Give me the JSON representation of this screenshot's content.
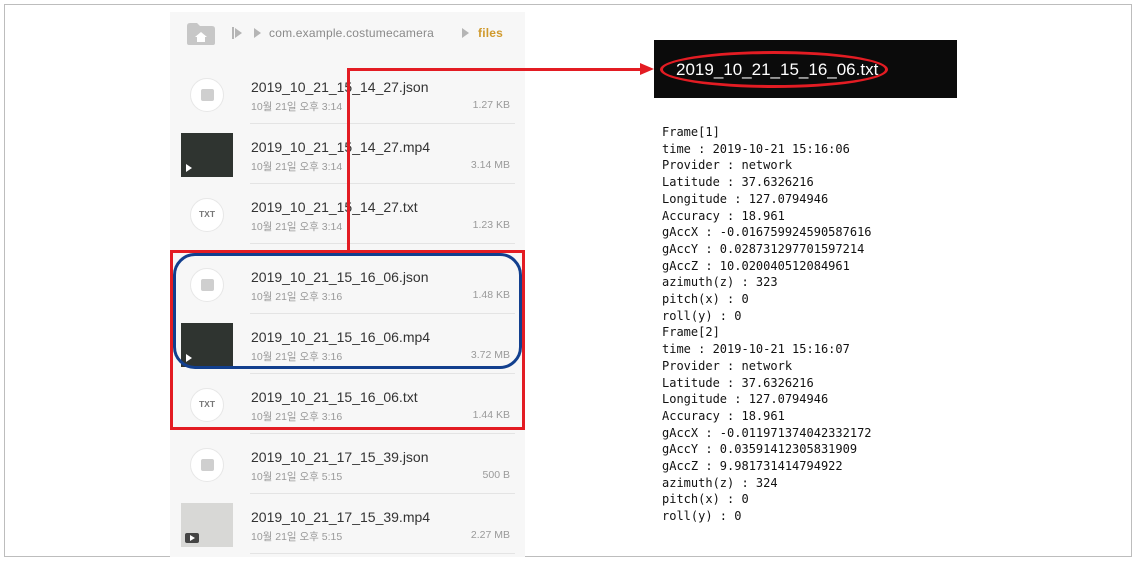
{
  "breadcrumb": {
    "package": "com.example.costumecamera",
    "current": "files"
  },
  "files": [
    {
      "name": "2019_10_21_15_14_27.json",
      "date": "10월 21일 오후 3:14",
      "size": "1.27 KB",
      "type": "json"
    },
    {
      "name": "2019_10_21_15_14_27.mp4",
      "date": "10월 21일 오후 3:14",
      "size": "3.14 MB",
      "type": "mp4"
    },
    {
      "name": "2019_10_21_15_14_27.txt",
      "date": "10월 21일 오후 3:14",
      "size": "1.23 KB",
      "type": "txt"
    },
    {
      "name": "2019_10_21_15_16_06.json",
      "date": "10월 21일 오후 3:16",
      "size": "1.48 KB",
      "type": "json"
    },
    {
      "name": "2019_10_21_15_16_06.mp4",
      "date": "10월 21일 오후 3:16",
      "size": "3.72 MB",
      "type": "mp4"
    },
    {
      "name": "2019_10_21_15_16_06.txt",
      "date": "10월 21일 오후 3:16",
      "size": "1.44 KB",
      "type": "txt"
    },
    {
      "name": "2019_10_21_17_15_39.json",
      "date": "10월 21일 오후 5:15",
      "size": "500 B",
      "type": "json"
    },
    {
      "name": "2019_10_21_17_15_39.mp4",
      "date": "10월 21일 오후 5:15",
      "size": "2.27 MB",
      "type": "mp4"
    }
  ],
  "txt_icon_label": "TXT",
  "viewer": {
    "title": "2019_10_21_15_16_06.txt",
    "lines": [
      "Frame[1]",
      "time : 2019-10-21 15:16:06",
      "Provider : network",
      "Latitude : 37.6326216",
      "Longitude : 127.0794946",
      "Accuracy : 18.961",
      "gAccX : -0.016759924590587616",
      "gAccY : 0.028731297701597214",
      "gAccZ : 10.020040512084961",
      "azimuth(z) : 323",
      "pitch(x) : 0",
      "roll(y) : 0",
      "Frame[2]",
      "time : 2019-10-21 15:16:07",
      "Provider : network",
      "Latitude : 37.6326216",
      "Longitude : 127.0794946",
      "Accuracy : 18.961",
      "gAccX : -0.011971374042332172",
      "gAccY : 0.03591412305831909",
      "gAccZ : 9.981731414794922",
      "azimuth(z) : 324",
      "pitch(x) : 0",
      "roll(y) : 0"
    ]
  },
  "colors": {
    "highlight_red": "#e31c23",
    "highlight_blue": "#123f8e",
    "breadcrumb_active": "#d09a2d"
  }
}
